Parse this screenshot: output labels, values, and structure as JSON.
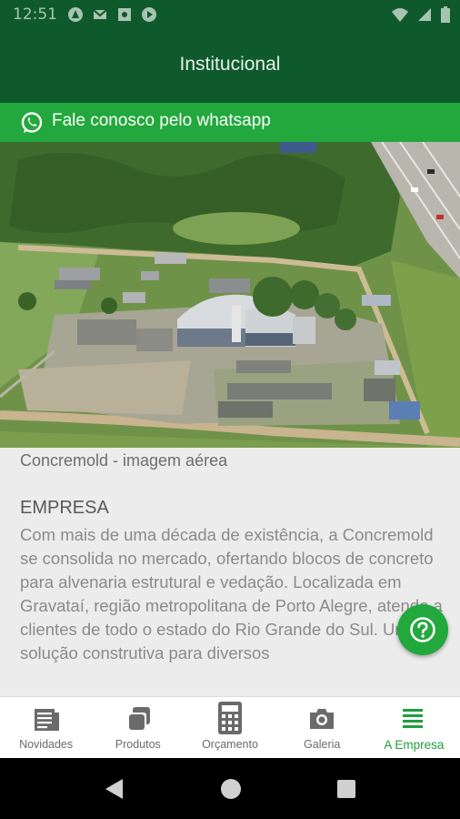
{
  "status_bar": {
    "time": "12:51",
    "notification_icons": [
      "android-auto-icon",
      "gmail-icon",
      "security-update-icon",
      "play-store-icon"
    ],
    "system_icons": [
      "wifi-icon",
      "signal-icon",
      "battery-icon"
    ]
  },
  "app_bar": {
    "title": "Institucional"
  },
  "whatsapp_banner": {
    "label": "Fale conosco pelo whatsapp",
    "icon": "whatsapp-icon"
  },
  "image": {
    "caption": "Concremold - imagem aérea",
    "subject": "aerial-photo"
  },
  "section": {
    "heading": "EMPRESA",
    "body": "Com mais de uma década de existência, a Concremold se consolida no mercado, ofertando blocos de concreto para alvenaria estrutural e vedação. Localizada em Gravataí, região metropolitana de Porto Alegre, atende a clientes de todo o estado do Rio Grande do Sul. Uma solução construtiva para diversos"
  },
  "help_fab": {
    "icon": "help-icon"
  },
  "bottom_nav": {
    "items": [
      {
        "label": "Novidades",
        "icon": "news-icon",
        "active": false
      },
      {
        "label": "Produtos",
        "icon": "products-icon",
        "active": false
      },
      {
        "label": "Orçamento",
        "icon": "calculator-icon",
        "active": false
      },
      {
        "label": "Galeria",
        "icon": "camera-icon",
        "active": false
      },
      {
        "label": "A Empresa",
        "icon": "company-list-icon",
        "active": true
      }
    ]
  },
  "colors": {
    "primary_dark": "#0e5a2c",
    "accent_green": "#22a83c",
    "active_nav": "#1f9e3c",
    "text_gray": "#8a8a8a"
  }
}
